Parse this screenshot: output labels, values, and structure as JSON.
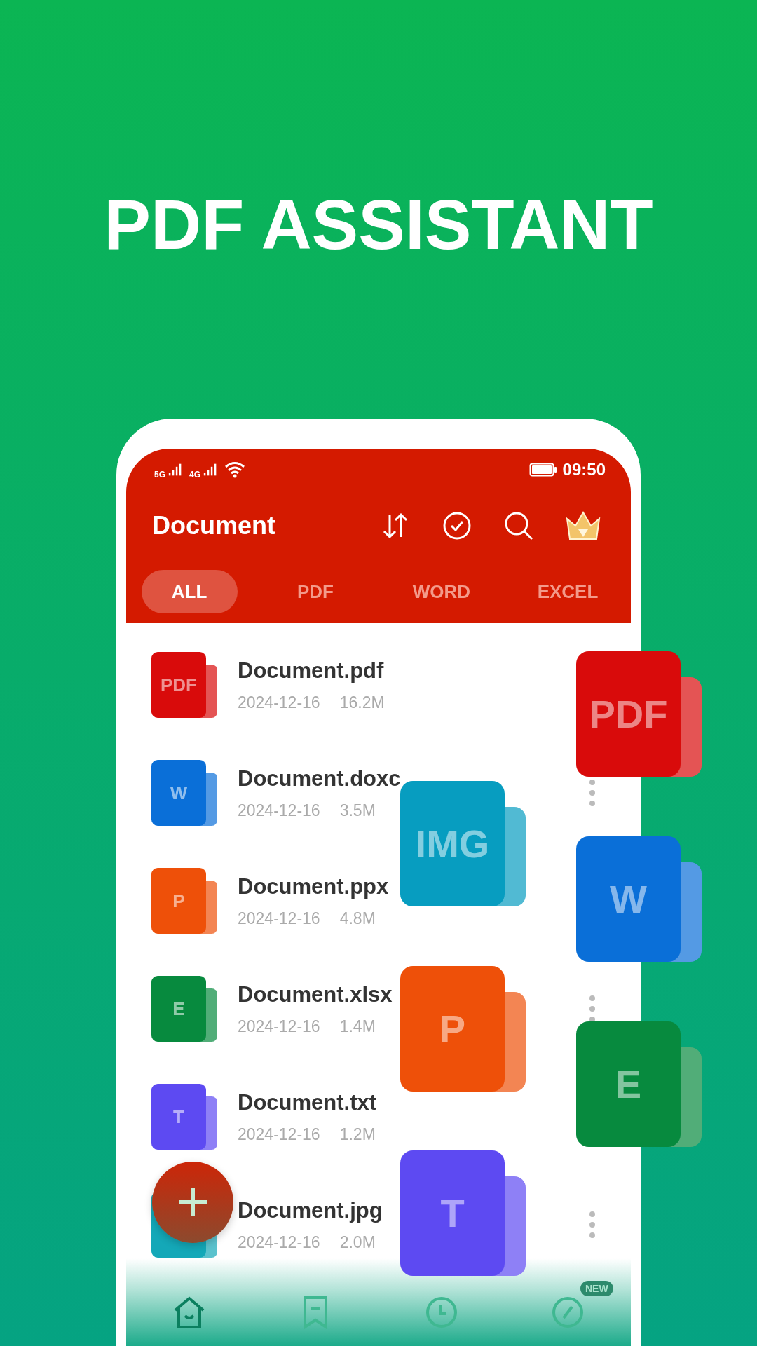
{
  "headline": "PDF ASSISTANT",
  "status_bar": {
    "network_1": "5G",
    "network_2": "4G",
    "time": "09:50"
  },
  "header": {
    "title": "Document"
  },
  "tabs": [
    {
      "label": "ALL",
      "selected": true
    },
    {
      "label": "PDF",
      "selected": false
    },
    {
      "label": "WORD",
      "selected": false
    },
    {
      "label": "EXCEL",
      "selected": false
    }
  ],
  "files": [
    {
      "name": "Document.pdf",
      "date": "2024-12-16",
      "size": "16.2M",
      "icon_label": "PDF",
      "color": "#d90b0b"
    },
    {
      "name": "Document.doxc",
      "date": "2024-12-16",
      "size": "3.5M",
      "icon_label": "W",
      "color": "#0a6fd8"
    },
    {
      "name": "Document.ppx",
      "date": "2024-12-16",
      "size": "4.8M",
      "icon_label": "P",
      "color": "#ee5009"
    },
    {
      "name": "Document.xlsx",
      "date": "2024-12-16",
      "size": "1.4M",
      "icon_label": "E",
      "color": "#078a3e"
    },
    {
      "name": "Document.txt",
      "date": "2024-12-16",
      "size": "1.2M",
      "icon_label": "T",
      "color": "#5d4af2"
    },
    {
      "name": "Document.jpg",
      "date": "2024-12-16",
      "size": "2.0M",
      "color": "#14a8b8"
    }
  ],
  "floating_tiles": [
    {
      "label": "PDF",
      "color": "#d90b0b"
    },
    {
      "label": "IMG",
      "color": "#079dc0"
    },
    {
      "label": "W",
      "color": "#0a6fd8"
    },
    {
      "label": "P",
      "color": "#ee5009"
    },
    {
      "label": "E",
      "color": "#078a3e"
    },
    {
      "label": "T",
      "color": "#5d4af2"
    }
  ],
  "bottom_nav": [
    {
      "kind": "home",
      "selected": true
    },
    {
      "kind": "bookmark",
      "selected": false
    },
    {
      "kind": "clock",
      "selected": false
    },
    {
      "kind": "compass",
      "selected": false,
      "badge": "NEW"
    }
  ]
}
